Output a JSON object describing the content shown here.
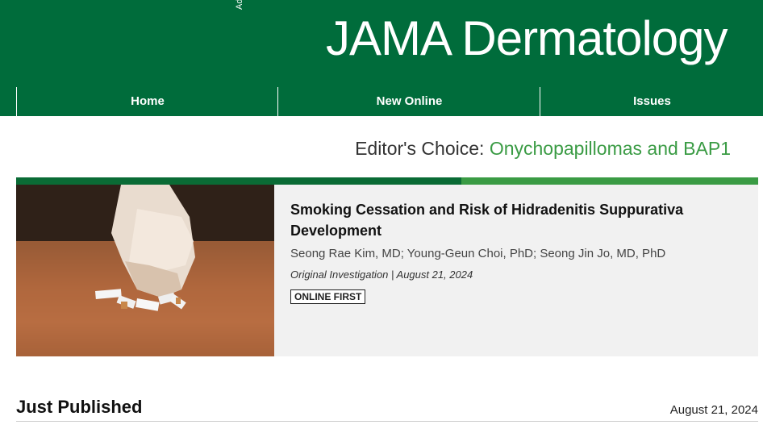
{
  "header": {
    "ad_label": "Ad",
    "journal_title": "JAMA Dermatology",
    "bg_color": "#006c3b"
  },
  "nav": {
    "items": [
      {
        "label": "Home"
      },
      {
        "label": "New Online"
      },
      {
        "label": "Issues"
      }
    ]
  },
  "editors_choice": {
    "prefix": "Editor's Choice: ",
    "topic": "Onychopapillomas and BAP1",
    "accent_color": "#3a9b44"
  },
  "featured": {
    "image_icon": "cigarettes-fist-photo",
    "title": "Smoking Cessation and Risk of Hidradenitis Suppurativa Development",
    "authors": "Seong Rae Kim, MD; Young-Geun Choi, PhD; Seong Jin Jo, MD, PhD",
    "meta": "Original Investigation | August 21, 2024",
    "badge": "ONLINE FIRST"
  },
  "just_published": {
    "heading": "Just Published",
    "date": "August 21, 2024"
  }
}
